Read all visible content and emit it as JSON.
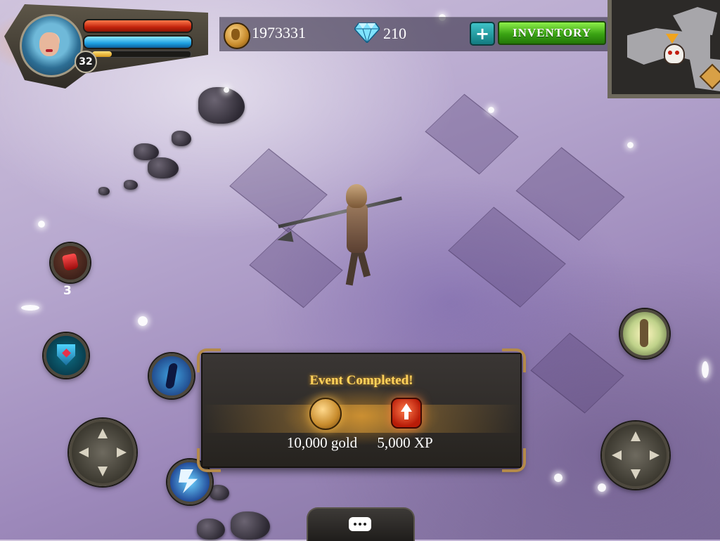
{
  "player": {
    "level": "32",
    "xp_fraction": 0.2
  },
  "currency": {
    "gold": "1973331",
    "gems": "210"
  },
  "header": {
    "plus_label": "+",
    "inventory_label": "INVENTORY"
  },
  "potion": {
    "count": "3"
  },
  "event": {
    "title": "Event Completed!",
    "gold_reward": "10,000 gold",
    "xp_reward": "5,000 XP"
  },
  "colors": {
    "health": "#c2230d",
    "mana": "#1d9fe0",
    "event_title": "#ffd25a",
    "inventory_button": "#3aa313"
  },
  "icons": {
    "portrait": "hero-portrait",
    "gold": "gold-coin-icon",
    "gem": "diamond-icon",
    "potion": "health-potion-icon",
    "skills": [
      "shield-skill-icon",
      "dash-skill-icon",
      "lightning-skill-icon",
      "heal-skill-icon"
    ],
    "minimap_markers": [
      "player-arrow-icon",
      "skull-icon",
      "exit-icon"
    ],
    "chat": "chat-bubble-icon"
  }
}
